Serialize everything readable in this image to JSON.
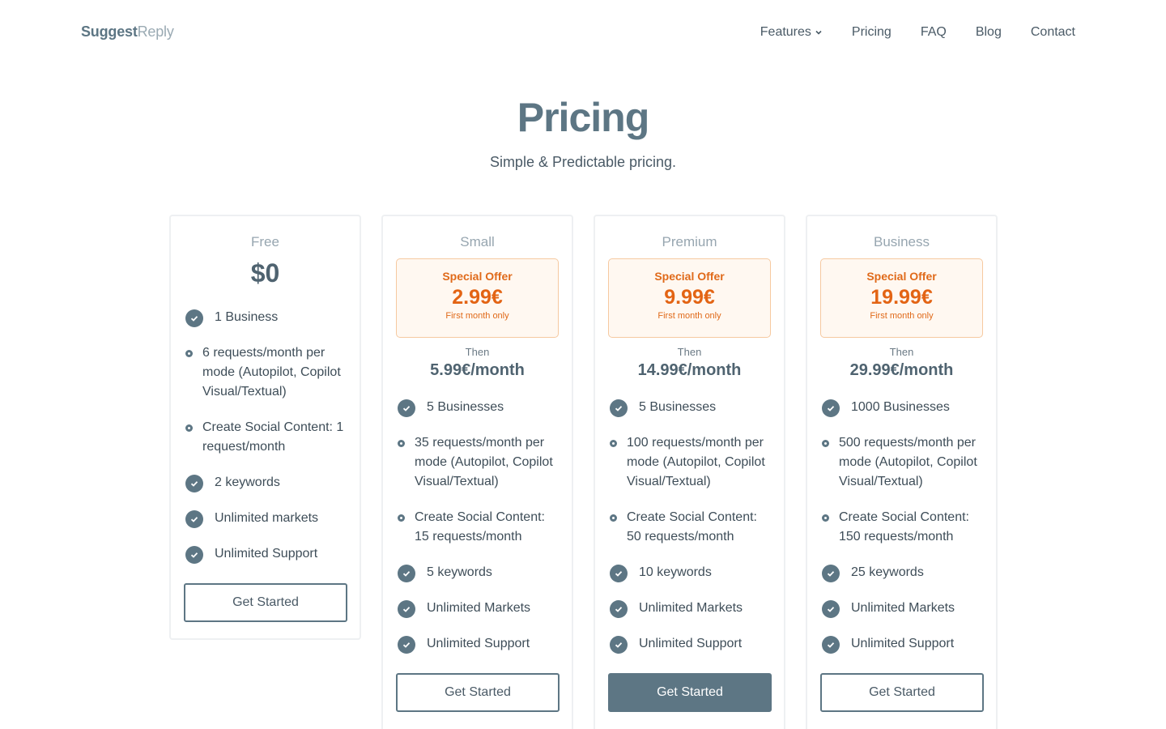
{
  "header": {
    "logo_bold": "Suggest",
    "logo_light": "Reply",
    "nav": [
      {
        "label": "Features"
      },
      {
        "label": "Pricing"
      },
      {
        "label": "FAQ"
      },
      {
        "label": "Blog"
      },
      {
        "label": "Contact"
      }
    ]
  },
  "hero": {
    "title": "Pricing",
    "subtitle": "Simple & Predictable pricing."
  },
  "plans": [
    {
      "name": "Free",
      "price": "$0",
      "features": [
        "1 Business",
        "6 requests/month per mode (Autopilot, Copilot Visual/Textual)",
        "Create Social Content: 1 request/month",
        "2 keywords",
        "Unlimited markets",
        "Unlimited Support"
      ],
      "cta": "Get Started"
    },
    {
      "name": "Small",
      "offer_label": "Special Offer",
      "offer_price": "2.99€",
      "offer_note": "First month only",
      "then_label": "Then",
      "then_price": "5.99€/month",
      "features": [
        "5 Businesses",
        "35 requests/month per mode (Autopilot, Copilot Visual/Textual)",
        "Create Social Content: 15 requests/month",
        "5 keywords",
        "Unlimited Markets",
        "Unlimited Support"
      ],
      "cta": "Get Started"
    },
    {
      "name": "Premium",
      "offer_label": "Special Offer",
      "offer_price": "9.99€",
      "offer_note": "First month only",
      "then_label": "Then",
      "then_price": "14.99€/month",
      "features": [
        "5 Businesses",
        "100 requests/month per mode (Autopilot, Copilot Visual/Textual)",
        "Create Social Content: 50 requests/month",
        "10 keywords",
        "Unlimited Markets",
        "Unlimited Support"
      ],
      "cta": "Get Started"
    },
    {
      "name": "Business",
      "offer_label": "Special Offer",
      "offer_price": "19.99€",
      "offer_note": "First month only",
      "then_label": "Then",
      "then_price": "29.99€/month",
      "features": [
        "1000 Businesses",
        "500 requests/month per mode (Autopilot, Copilot Visual/Textual)",
        "Create Social Content: 150 requests/month",
        "25 keywords",
        "Unlimited Markets",
        "Unlimited Support"
      ],
      "cta": "Get Started"
    }
  ],
  "icons": {
    "feature_check": "check-circle-icon",
    "feature_bullet": "bullet-dot-icon",
    "nav_dropdown": "chevron-down-icon"
  },
  "colors": {
    "primary": "#5d7684",
    "offer_accent": "#e36414",
    "offer_bg": "#fff8f1"
  }
}
